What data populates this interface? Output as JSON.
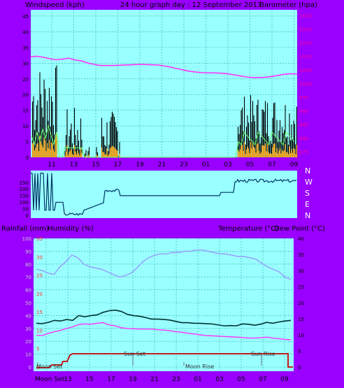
{
  "colors": {
    "frame": "#9900ff",
    "plot_bg": "#99ffff",
    "grid": "#33aaaa",
    "wind": "#000000",
    "gust": "#ff9900",
    "avg": "#66ff66",
    "baro": "#ff33ff",
    "dir": "#003366",
    "hum": "#9999ff",
    "temp": "#003333",
    "dew": "#ff33ff",
    "rain": "#cc0000"
  },
  "header": {
    "left": "Windspeed (kph)",
    "center": "24 hour graph day : 12 September 2017",
    "right": "Barometer (hpa)"
  },
  "dir_labels": [
    "N",
    "W",
    "S",
    "E",
    "N"
  ],
  "lower_header": {
    "left1": "Rainfall (mm)",
    "left2": "Humidity (%)",
    "right1": "Temperature (°C)",
    "right2": "Dew Point (°C)"
  },
  "events": {
    "moon_set": "Moon Set",
    "sun_set": "Sun Set",
    "moon_rise": "Moon Rise",
    "sun_rise": "Sun Rise",
    "moon_set_axis": "Moon Set"
  },
  "chart_data": [
    {
      "type": "line",
      "x_ticks": [
        "11",
        "13",
        "15",
        "17",
        "19",
        "21",
        "23",
        "01",
        "03",
        "05",
        "07",
        "09"
      ],
      "y_left_ticks": [
        0,
        5,
        10,
        15,
        20,
        25,
        30,
        35,
        40,
        45
      ],
      "y_right_ticks": [
        975,
        980,
        985,
        990,
        995,
        1000,
        1005,
        1010,
        1015,
        1020,
        1025
      ],
      "ylim_left": [
        0,
        47
      ],
      "ylim_right": [
        973,
        1027
      ],
      "series": [
        {
          "name": "Barometer",
          "values": [
            1009.8,
            1010.0,
            1009.6,
            1009.1,
            1008.7,
            1008.9,
            1009.3,
            1008.6,
            1008.3,
            1007.5,
            1007.0,
            1006.6,
            1006.6,
            1006.6,
            1006.7,
            1006.8,
            1006.9,
            1007.0,
            1007.0,
            1006.9,
            1006.8,
            1006.5,
            1006.0,
            1005.5,
            1005.0,
            1004.5,
            1004.2,
            1004.0,
            1003.9,
            1003.9,
            1003.8,
            1003.6,
            1003.2,
            1002.8,
            1002.4,
            1002.2,
            1002.2,
            1002.3,
            1002.6,
            1003.0,
            1003.4,
            1003.6,
            1003.5
          ]
        }
      ]
    },
    {
      "type": "line",
      "series": [
        {
          "name": "Wind direction"
        }
      ]
    },
    {
      "type": "line",
      "x_ticks": [
        "11",
        "13",
        "15",
        "17",
        "19",
        "21",
        "23",
        "01",
        "03",
        "05",
        "07",
        "09"
      ],
      "y_left_ticks": [
        0,
        10,
        20,
        30,
        40,
        50,
        60,
        70,
        80,
        90,
        100
      ],
      "y_rain_ticks": [
        0,
        5,
        10,
        15,
        20,
        25,
        30,
        35
      ],
      "y_right_ticks": [
        0,
        5,
        10,
        15,
        20,
        25,
        30,
        35,
        40
      ],
      "ylim_left": [
        0,
        100
      ],
      "ylim_right": [
        0,
        40
      ],
      "series": [
        {
          "name": "Humidity",
          "values": [
            76,
            75,
            73,
            72,
            78,
            82,
            87,
            85,
            80,
            78,
            77,
            76,
            74,
            72,
            70,
            71,
            73,
            77,
            82,
            85,
            87,
            88,
            88,
            89,
            89,
            90,
            90,
            91,
            91,
            90,
            89,
            88,
            88,
            87,
            86,
            86,
            85,
            84,
            81,
            78,
            76,
            74,
            70,
            68
          ]
        },
        {
          "name": "Temperature",
          "values": [
            13.6,
            13.5,
            13.9,
            14.5,
            14.3,
            14.8,
            14.5,
            16.0,
            15.6,
            16.0,
            16.2,
            17.0,
            17.5,
            17.7,
            17.3,
            16.4,
            16.0,
            15.8,
            15.4,
            14.9,
            14.9,
            14.8,
            14.6,
            14.2,
            13.8,
            13.8,
            13.6,
            13.6,
            13.5,
            13.4,
            13.1,
            12.8,
            12.9,
            12.8,
            13.4,
            13.3,
            13.0,
            13.3,
            13.9,
            13.6,
            14.0,
            14.3,
            14.5
          ]
        },
        {
          "name": "Dew Point",
          "values": [
            9.9,
            9.8,
            10.5,
            11.0,
            11.4,
            12.0,
            12.5,
            13.2,
            13.4,
            13.3,
            13.6,
            13.8,
            13.1,
            12.8,
            12.2,
            12.0,
            11.9,
            11.8,
            11.8,
            11.8,
            11.6,
            11.5,
            11.3,
            11.0,
            10.8,
            10.5,
            10.3,
            10.0,
            9.8,
            9.7,
            9.6,
            9.5,
            9.4,
            9.3,
            9.2,
            9.0,
            9.0,
            9.1,
            9.3,
            9.0,
            8.8,
            8.6,
            8.5
          ]
        }
      ]
    }
  ]
}
